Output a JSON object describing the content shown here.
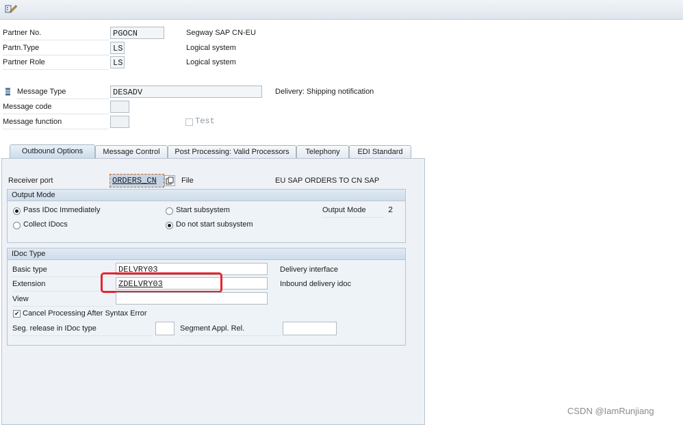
{
  "header": {
    "partner_no": {
      "label": "Partner No.",
      "value": "PGOCN",
      "desc": "Segway SAP CN-EU"
    },
    "partner_type": {
      "label": "Partn.Type",
      "value": "LS",
      "desc": "Logical system"
    },
    "partner_role": {
      "label": "Partner Role",
      "value": "LS",
      "desc": "Logical system"
    },
    "message_type": {
      "label": "Message Type",
      "value": "DESADV",
      "desc": "Delivery: Shipping notification"
    },
    "message_code": {
      "label": "Message code",
      "value": ""
    },
    "message_function": {
      "label": "Message function",
      "value": ""
    },
    "test": {
      "label": "Test",
      "checked": false
    }
  },
  "tabs": [
    {
      "label": "Outbound Options",
      "active": true
    },
    {
      "label": "Message Control",
      "active": false
    },
    {
      "label": "Post Processing: Valid Processors",
      "active": false
    },
    {
      "label": "Telephony",
      "active": false
    },
    {
      "label": "EDI Standard",
      "active": false
    }
  ],
  "outbound": {
    "receiver_port": {
      "label": "Receiver port",
      "value": "ORDERS_CN",
      "port_type": "File",
      "desc": "EU SAP ORDERS TO CN SAP"
    },
    "output_mode": {
      "title": "Output Mode",
      "pass_immediately": {
        "label": "Pass IDoc Immediately",
        "selected": true
      },
      "collect": {
        "label": "Collect IDocs",
        "selected": false
      },
      "start_subsystem": {
        "label": "Start subsystem",
        "selected": false
      },
      "no_start_subsystem": {
        "label": "Do not start subsystem",
        "selected": true
      },
      "output_mode_label": "Output Mode",
      "output_mode_value": "2"
    },
    "idoc_type": {
      "title": "IDoc Type",
      "basic_type": {
        "label": "Basic type",
        "value": "DELVRY03",
        "desc": "Delivery interface"
      },
      "extension": {
        "label": "Extension",
        "value": "ZDELVRY03",
        "desc": "Inbound delivery idoc"
      },
      "view": {
        "label": "View",
        "value": ""
      },
      "cancel_processing": {
        "label": "Cancel Processing After Syntax Error",
        "checked": true
      },
      "seg_release": {
        "label": "Seg. release in IDoc type",
        "value": ""
      },
      "segment_appl_rel": {
        "label": "Segment Appl. Rel.",
        "value": ""
      }
    }
  },
  "highlight_color": "#e8242b",
  "watermark": "CSDN @IamRunjiang"
}
